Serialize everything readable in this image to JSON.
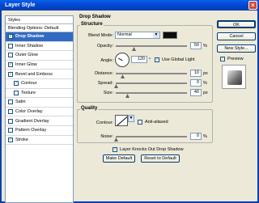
{
  "window": {
    "title": "Layer Style"
  },
  "styles": {
    "header": "Styles",
    "blend_default": "Blending Options: Default",
    "items": [
      {
        "label": "Drop Shadow",
        "checked": true,
        "active": true
      },
      {
        "label": "Inner Shadow",
        "checked": false
      },
      {
        "label": "Outer Glow",
        "checked": false
      },
      {
        "label": "Inner Glow",
        "checked": true
      },
      {
        "label": "Bevel and Emboss",
        "checked": true
      },
      {
        "label": "Contour",
        "checked": true,
        "sub": true
      },
      {
        "label": "Texture",
        "checked": false,
        "sub": true
      },
      {
        "label": "Satin",
        "checked": false
      },
      {
        "label": "Color Overlay",
        "checked": false
      },
      {
        "label": "Gradient Overlay",
        "checked": false
      },
      {
        "label": "Pattern Overlay",
        "checked": false
      },
      {
        "label": "Stroke",
        "checked": true
      }
    ]
  },
  "drop_shadow": {
    "title": "Drop Shadow",
    "structure_title": "Structure",
    "blend_mode_label": "Blend Mode:",
    "blend_mode_value": "Normal",
    "shadow_color": "#0d0d0d",
    "opacity_label": "Opacity:",
    "opacity_value": "50",
    "opacity_unit": "%",
    "angle_label": "Angle:",
    "angle_value": "120",
    "angle_unit": "°",
    "global_light_label": "Use Global Light",
    "distance_label": "Distance:",
    "distance_value": "10",
    "distance_unit": "px",
    "spread_label": "Spread:",
    "spread_value": "0",
    "spread_unit": "%",
    "size_label": "Size:",
    "size_value": "40",
    "size_unit": "px",
    "quality_title": "Quality",
    "contour_label": "Contour:",
    "anti_aliased_label": "Anti-aliased",
    "noise_label": "Noise:",
    "noise_value": "0",
    "noise_unit": "%",
    "knockout_label": "Layer Knocks Out Drop Shadow",
    "make_default_label": "Make Default",
    "reset_default_label": "Reset to Default"
  },
  "buttons": {
    "ok": "OK",
    "cancel": "Cancel",
    "new_style": "New Style...",
    "preview_label": "Preview"
  }
}
